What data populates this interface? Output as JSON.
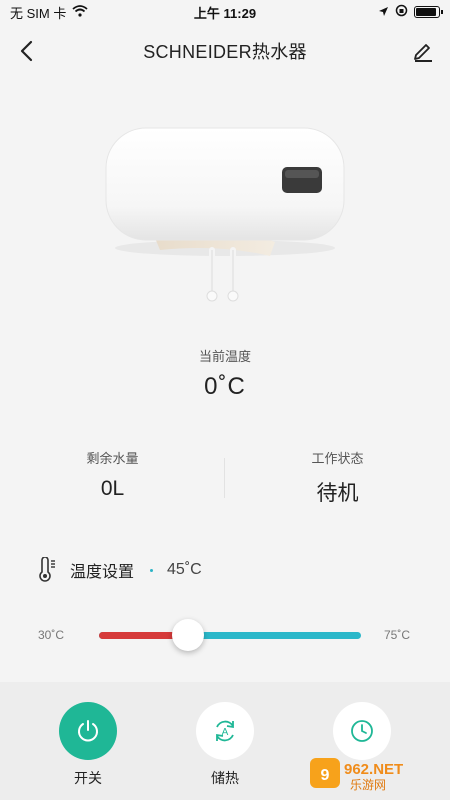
{
  "status_bar": {
    "carrier": "无 SIM 卡",
    "time": "上午 11:29"
  },
  "nav": {
    "title": "SCHNEIDER热水器"
  },
  "current_temp": {
    "label": "当前温度",
    "value": "0˚C"
  },
  "stats": {
    "water": {
      "label": "剩余水量",
      "value": "0L"
    },
    "status": {
      "label": "工作状态",
      "value": "待机"
    }
  },
  "temp_setting": {
    "label": "温度设置",
    "value": "45˚C"
  },
  "slider": {
    "min_label": "30˚C",
    "max_label": "75˚C",
    "level": 0.34
  },
  "actions": [
    {
      "label": "开关",
      "icon": "power-icon"
    },
    {
      "label": "储热",
      "icon": "auto-cycle-icon"
    },
    {
      "label": "",
      "icon": "clock-icon"
    }
  ],
  "watermark": {
    "brand": "962.NET",
    "sub": "乐游网"
  },
  "colors": {
    "accent_green": "#1fb796",
    "slider_hot": "#d63a3a",
    "slider_cold": "#2ab7c9"
  }
}
